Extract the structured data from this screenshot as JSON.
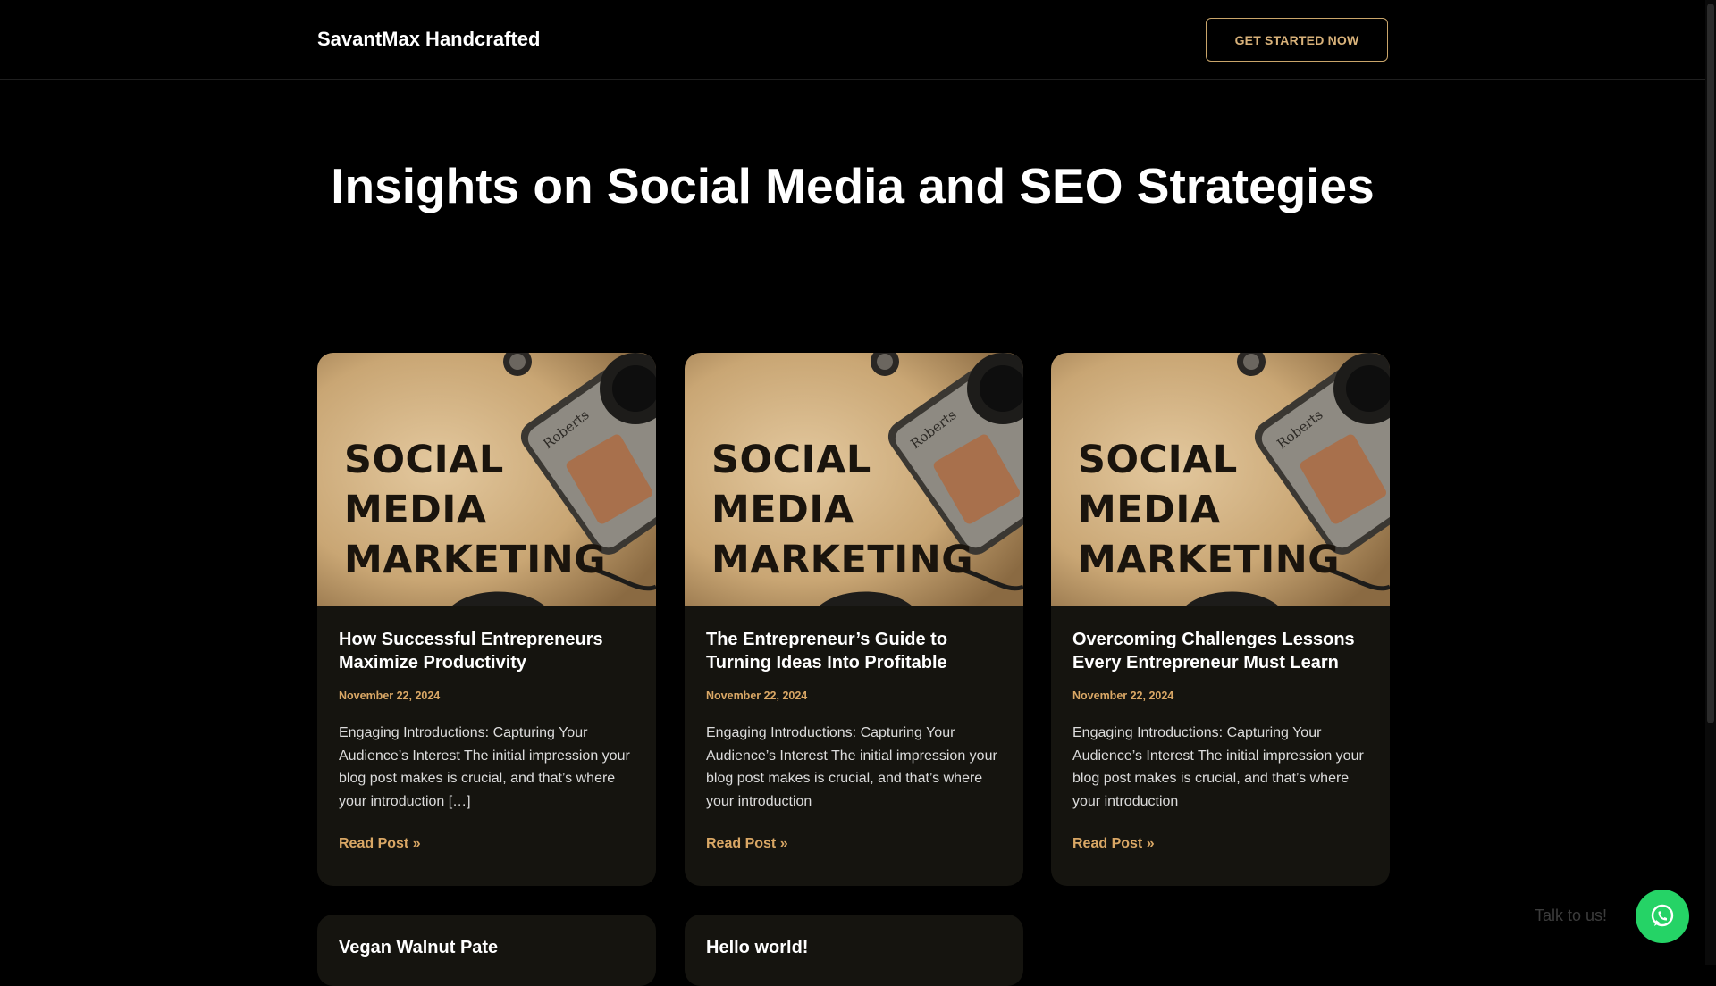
{
  "header": {
    "brand": "SavantMax Handcrafted",
    "cta_label": "GET STARTED NOW"
  },
  "page": {
    "title": "Insights on Social Media and SEO Strategies"
  },
  "thumbnail": {
    "line1": "SOCIAL",
    "line2": "MEDIA",
    "line3": "MARKETING"
  },
  "posts": [
    {
      "title": "How Successful Entrepreneurs Maximize Productivity",
      "date": "November 22, 2024",
      "excerpt": "Engaging Introductions: Capturing Your Audience’s Interest The initial impression your blog post makes is crucial, and that’s where your introduction […]",
      "read_more": "Read Post »"
    },
    {
      "title": "The Entrepreneur’s Guide to Turning Ideas Into Profitable",
      "date": "November 22, 2024",
      "excerpt": "Engaging Introductions: Capturing Your Audience’s Interest The initial impression your blog post makes is crucial, and that’s where your introduction",
      "read_more": "Read Post »"
    },
    {
      "title": "Overcoming Challenges Lessons Every Entrepreneur Must Learn",
      "date": "November 22, 2024",
      "excerpt": "Engaging Introductions: Capturing Your Audience’s Interest The initial impression your blog post makes is crucial, and that’s where your introduction",
      "read_more": "Read Post »"
    },
    {
      "title": "Vegan Walnut Pate"
    },
    {
      "title": "Hello world!"
    }
  ],
  "chat": {
    "label": "Talk to us!",
    "icon": "whatsapp-icon"
  },
  "colors": {
    "accent": "#d9a765",
    "card_bg": "#15140f",
    "whatsapp": "#25d366"
  }
}
